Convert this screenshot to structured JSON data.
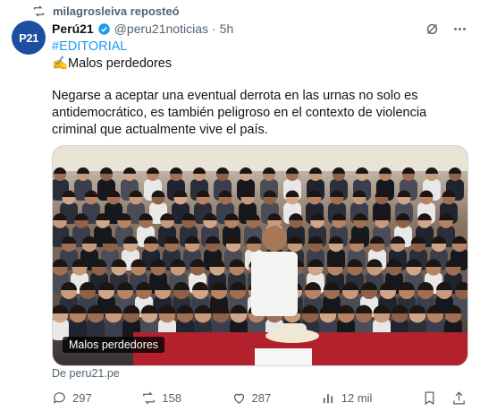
{
  "repost": {
    "icon": "repost-icon",
    "text": "milagrosleiva reposteó"
  },
  "author": {
    "avatar_text": "P21",
    "name": "Perú21",
    "handle": "@peru21noticias",
    "separator": "·",
    "time": "5h",
    "verified_color": "#1d9bf0"
  },
  "post": {
    "hashtag": "#EDITORIAL",
    "headline": "✍️Malos perdedores",
    "body": "Negarse a aceptar una eventual derrota en las urnas no solo es antidemocrático, es también peligroso en el contexto de violencia criminal que actualmente vive el país.",
    "media_caption": "Malos perdedores",
    "source": "De peru21.pe"
  },
  "actions": {
    "replies": "297",
    "reposts": "158",
    "likes": "287",
    "views": "12 mil"
  },
  "colors": {
    "accent": "#1d9bf0",
    "muted": "#536471",
    "brand": "#1d4ea1"
  }
}
